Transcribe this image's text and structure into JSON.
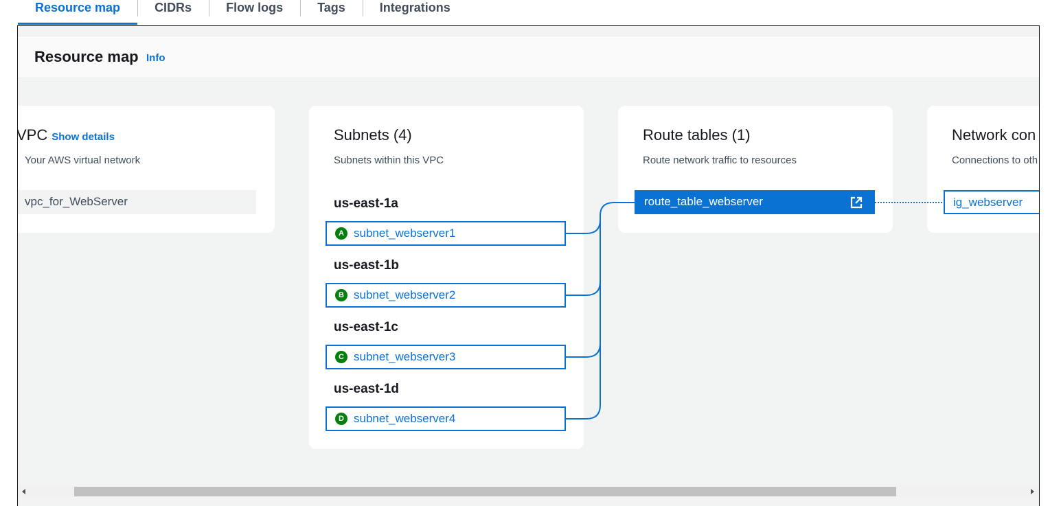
{
  "tabs": [
    {
      "label": "Resource map",
      "active": true
    },
    {
      "label": "CIDRs"
    },
    {
      "label": "Flow logs"
    },
    {
      "label": "Tags"
    },
    {
      "label": "Integrations"
    }
  ],
  "header": {
    "title": "Resource map",
    "info_label": "Info"
  },
  "vpc": {
    "title": "VPC",
    "show_details_label": "Show details",
    "subtitle": "Your AWS virtual network",
    "name": "vpc_for_WebServer"
  },
  "subnets": {
    "title": "Subnets (4)",
    "subtitle": "Subnets within this VPC",
    "groups": [
      {
        "az": "us-east-1a",
        "badge": "A",
        "name": "subnet_webserver1"
      },
      {
        "az": "us-east-1b",
        "badge": "B",
        "name": "subnet_webserver2"
      },
      {
        "az": "us-east-1c",
        "badge": "C",
        "name": "subnet_webserver3"
      },
      {
        "az": "us-east-1d",
        "badge": "D",
        "name": "subnet_webserver4"
      }
    ]
  },
  "route_tables": {
    "title": "Route tables (1)",
    "subtitle": "Route network traffic to resources",
    "items": [
      {
        "name": "route_table_webserver",
        "icon": "external-link-icon"
      }
    ]
  },
  "network_connections": {
    "title": "Network con",
    "subtitle": "Connections to oth",
    "items": [
      {
        "name": "ig_webserver"
      }
    ]
  },
  "colors": {
    "accent": "#0972d3",
    "badge_green": "#037f0c",
    "panel_bg": "#f2f3f3"
  }
}
